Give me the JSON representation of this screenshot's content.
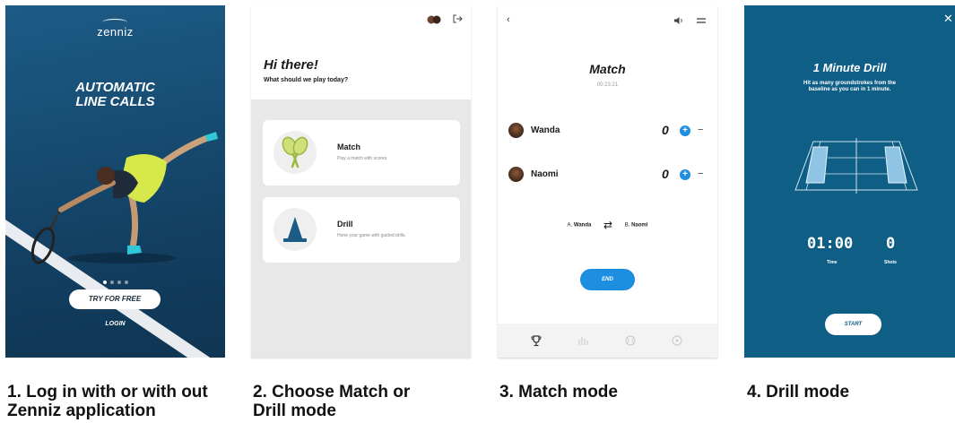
{
  "panel1": {
    "logo": "zenniz",
    "headline_line1": "AUTOMATIC",
    "headline_line2": "LINE CALLS",
    "pager_dots": 4,
    "pager_active": 0,
    "try_button": "TRY FOR FREE",
    "login": "LOGIN"
  },
  "panel2": {
    "greeting": "Hi there!",
    "subtitle": "What should we play today?",
    "cards": [
      {
        "title": "Match",
        "description": "Play a match with scores.",
        "icon": "tennis-rackets-icon"
      },
      {
        "title": "Drill",
        "description": "Hone your game with guided drills.",
        "icon": "cone-icon"
      }
    ]
  },
  "panel3": {
    "title": "Match",
    "timer": "00:23:21",
    "players": [
      {
        "name": "Wanda",
        "score": "0"
      },
      {
        "name": "Naomi",
        "score": "0"
      }
    ],
    "serve_left_prefix": "A.",
    "serve_left_name": "Wanda",
    "serve_right_prefix": "B.",
    "serve_right_name": "Naomi",
    "end_button": "END",
    "plus_symbol": "+",
    "minus_symbol": "−"
  },
  "panel4": {
    "title": "1 Minute Drill",
    "description": "Hit as many groundstrokes from the baseline as you can in 1 minute.",
    "time_value": "01:00",
    "time_label": "Time",
    "shots_value": "0",
    "shots_label": "Shots",
    "start_button": "START"
  },
  "captions": [
    "1. Log in with or with out Zenniz application",
    "2. Choose Match or Drill mode",
    "3. Match mode",
    "4. Drill mode"
  ],
  "colors": {
    "accent_blue": "#1e8ee0",
    "drill_bg": "#0f5e86",
    "login_bg": "#174d74",
    "court_highlight": "#8fc4e4"
  }
}
